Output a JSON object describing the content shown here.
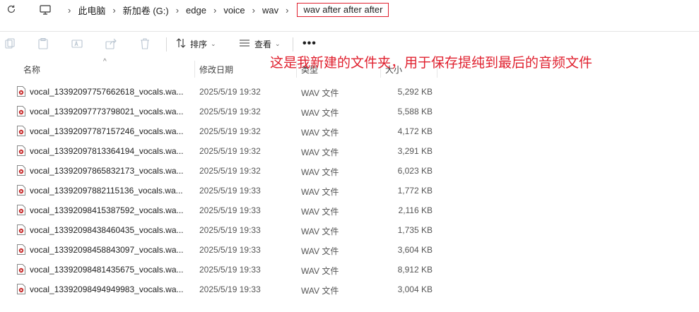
{
  "address_bar": {
    "crumbs": [
      "此电脑",
      "新加卷 (G:)",
      "edge",
      "voice",
      "wav",
      "wav after after after"
    ]
  },
  "toolbar": {
    "sort_label": "排序",
    "view_label": "查看",
    "more_label": "•••"
  },
  "annotation": "这是我新建的文件夹，用于保存提纯到最后的音频文件",
  "columns": {
    "name": "名称",
    "date": "修改日期",
    "type": "类型",
    "size": "大小"
  },
  "files": [
    {
      "name": "vocal_13392097757662618_vocals.wa...",
      "date": "2025/5/19 19:32",
      "type": "WAV 文件",
      "size": "5,292 KB"
    },
    {
      "name": "vocal_13392097773798021_vocals.wa...",
      "date": "2025/5/19 19:32",
      "type": "WAV 文件",
      "size": "5,588 KB"
    },
    {
      "name": "vocal_13392097787157246_vocals.wa...",
      "date": "2025/5/19 19:32",
      "type": "WAV 文件",
      "size": "4,172 KB"
    },
    {
      "name": "vocal_13392097813364194_vocals.wa...",
      "date": "2025/5/19 19:32",
      "type": "WAV 文件",
      "size": "3,291 KB"
    },
    {
      "name": "vocal_13392097865832173_vocals.wa...",
      "date": "2025/5/19 19:32",
      "type": "WAV 文件",
      "size": "6,023 KB"
    },
    {
      "name": "vocal_13392097882115136_vocals.wa...",
      "date": "2025/5/19 19:33",
      "type": "WAV 文件",
      "size": "1,772 KB"
    },
    {
      "name": "vocal_13392098415387592_vocals.wa...",
      "date": "2025/5/19 19:33",
      "type": "WAV 文件",
      "size": "2,116 KB"
    },
    {
      "name": "vocal_13392098438460435_vocals.wa...",
      "date": "2025/5/19 19:33",
      "type": "WAV 文件",
      "size": "1,735 KB"
    },
    {
      "name": "vocal_13392098458843097_vocals.wa...",
      "date": "2025/5/19 19:33",
      "type": "WAV 文件",
      "size": "3,604 KB"
    },
    {
      "name": "vocal_13392098481435675_vocals.wa...",
      "date": "2025/5/19 19:33",
      "type": "WAV 文件",
      "size": "8,912 KB"
    },
    {
      "name": "vocal_13392098494949983_vocals.wa...",
      "date": "2025/5/19 19:33",
      "type": "WAV 文件",
      "size": "3,004 KB"
    }
  ],
  "colors": {
    "annotation": "#e0212f",
    "highlight_border": "#e0212f"
  }
}
